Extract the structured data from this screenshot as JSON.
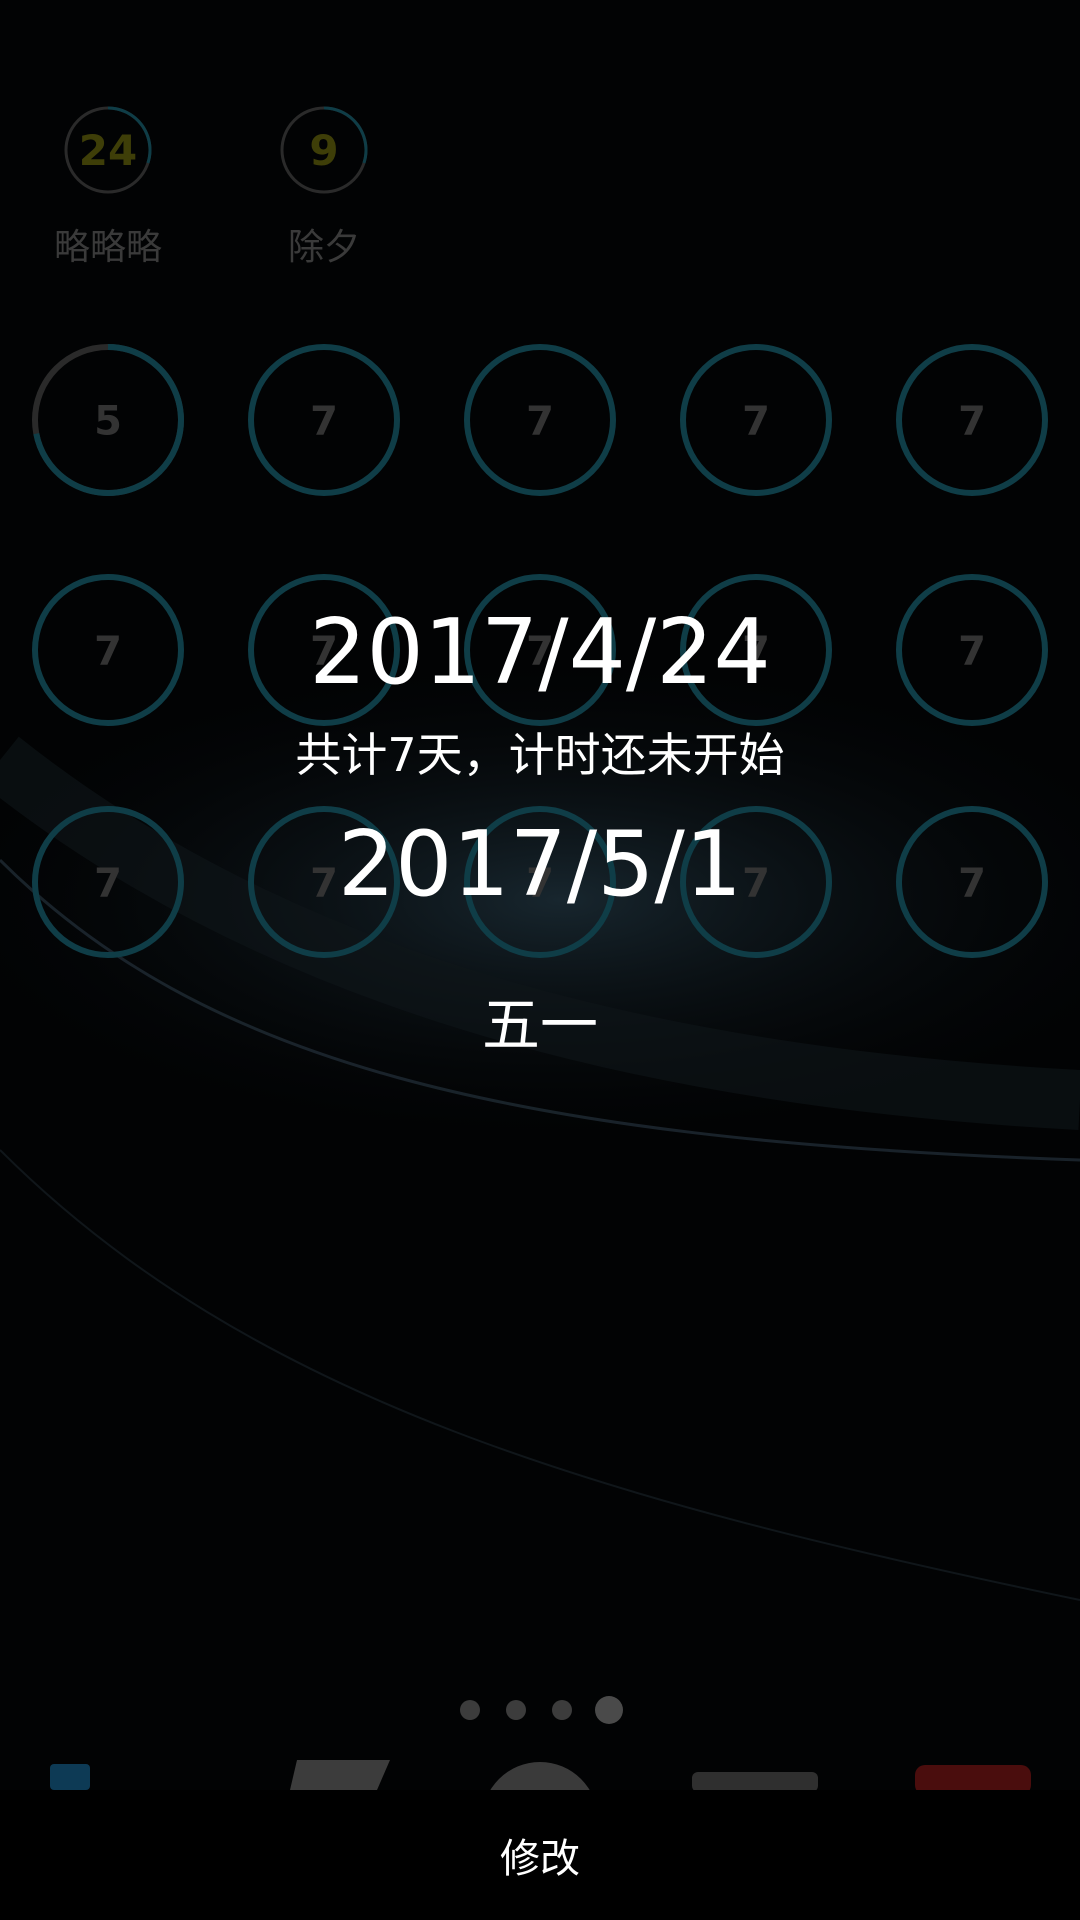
{
  "top_widgets": [
    {
      "number": "24",
      "label": "略略略",
      "progress": 0.3
    },
    {
      "number": "9",
      "label": "除夕",
      "progress": 0.3
    }
  ],
  "ring_grid": [
    [
      "5",
      "7",
      "7",
      "7",
      "7"
    ],
    [
      "7",
      "7",
      "7",
      "7",
      "7"
    ],
    [
      "7",
      "7",
      "7",
      "7",
      "7"
    ]
  ],
  "ring_progress": {
    "first": 0.72,
    "others": 0
  },
  "popup": {
    "start_date": "2017/4/24",
    "duration": "共计7天，计时还未开始",
    "end_date": "2017/5/1",
    "event_name": "五一"
  },
  "page_indicator": {
    "count": 4,
    "active": 3
  },
  "bottom": {
    "edit_label": "修改"
  },
  "colors": {
    "ring_accent": "#0f3d47",
    "ring_track": "#2a2a2a",
    "top_number": "#3e3e08",
    "dim_text": "#3a3a3a"
  }
}
